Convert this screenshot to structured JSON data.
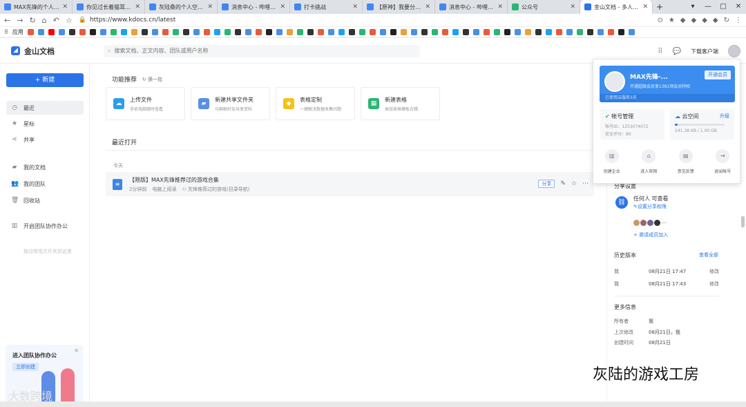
{
  "browser": {
    "tabs": [
      {
        "label": "MAX先锋的个人空间_",
        "color": "#4285f4"
      },
      {
        "label": "你见过长着猫耳的海盗",
        "color": "#4a90e2"
      },
      {
        "label": "灰陆桑的个人空间_哔哩",
        "color": "#4a90e2"
      },
      {
        "label": "消息中心 - 哔哩哔哩弹",
        "color": "#4a90e2"
      },
      {
        "label": "打卡挑战",
        "color": "#4a90e2"
      },
      {
        "label": "【原神】我要分享一下",
        "color": "#4a90e2"
      },
      {
        "label": "消息中心 - 哔哩哔哩弹",
        "color": "#4a90e2"
      },
      {
        "label": "公众号",
        "color": "#2bb673"
      },
      {
        "label": "金山文档 - 多人实时协",
        "color": "#2b74e8"
      }
    ],
    "url": "https://www.kdocs.cn/latest",
    "bookmarks_apps_label": "应用"
  },
  "app": {
    "name": "金山文档",
    "search_placeholder": "搜索文档、正文内容、团队或用户名称",
    "download_label": "下载客户端"
  },
  "sidebar": {
    "new_button": "+ 新建",
    "items": [
      {
        "label": "最近",
        "icon": "clock-icon"
      },
      {
        "label": "星标",
        "icon": "star-icon"
      },
      {
        "label": "共享",
        "icon": "share-icon"
      },
      {
        "label": "我的文档",
        "icon": "folder-icon"
      },
      {
        "label": "我的团队",
        "icon": "team-icon"
      },
      {
        "label": "回收站",
        "icon": "trash-icon"
      },
      {
        "label": "开启团队协作办公",
        "icon": "building-icon"
      }
    ],
    "tip": "拖动常用文件夹到这里",
    "promo_title": "进入团队协作办公",
    "promo_button": "立即创建"
  },
  "main": {
    "feature_title": "功能推荐",
    "feature_refresh": "换一批",
    "cards": [
      {
        "title": "上传文件",
        "desc": "手机电脑随时查看",
        "color": "#2b9ef0",
        "icon": "cloud-upload-icon"
      },
      {
        "title": "新建共享文件夹",
        "desc": "与群聊好友共享资料",
        "color": "#5b8ee6",
        "icon": "shared-folder-icon"
      },
      {
        "title": "表格定制",
        "desc": "一键解决数据收集问题",
        "color": "#f5c21a",
        "icon": "diamond-icon"
      },
      {
        "title": "新建表格",
        "desc": "高效表格模板合辑",
        "color": "#2bb673",
        "icon": "sheet-icon"
      }
    ],
    "recent_title": "最近打开",
    "today_label": "今天",
    "file": {
      "name": "【限版】MAX先锋推荐过的游戏合集",
      "time": "2分钟前",
      "source": "电脑上阅读",
      "owner": "先锋推荐过的游戏(目录导航)",
      "share_label": "分享"
    }
  },
  "popup": {
    "name": "MAX先锋-...",
    "desc": "开通超级会员享1381项会员特权",
    "upgrade": "开通会员",
    "used": "已使用云服务3天",
    "account_title": "帐号管理",
    "account_id": "帐号ID：1253074072",
    "security": "安全评分：80",
    "storage_title": "云空间",
    "storage_upgrade": "升级",
    "storage_used": "241.38 KB / 1.00 GB",
    "storage_fraction": 0.05,
    "actions": [
      {
        "label": "创建企业",
        "icon": "enterprise-icon"
      },
      {
        "label": "进入官网",
        "icon": "home-icon"
      },
      {
        "label": "意见反馈",
        "icon": "feedback-icon"
      },
      {
        "label": "退出帐号",
        "icon": "logout-icon"
      }
    ]
  },
  "rightpanel": {
    "share_title": "分享设置",
    "share_who": "任何人 可查看",
    "share_link": "设置分享权限",
    "invite": "+ 邀请成员加入",
    "history_title": "历史版本",
    "history_all": "查看全部",
    "history": [
      {
        "who": "我",
        "time": "08月21日 17:47",
        "action": "修改"
      },
      {
        "who": "我",
        "time": "08月21日 17:43",
        "action": "修改"
      }
    ],
    "more_title": "更多信息",
    "info": [
      {
        "k": "所有者",
        "v": "我"
      },
      {
        "k": "上次修改",
        "v": "08月21日，我"
      },
      {
        "k": "创建时间",
        "v": "08月21日"
      }
    ]
  },
  "watermarks": {
    "right": "灰陆的游戏工房",
    "left": "大数跨境"
  }
}
